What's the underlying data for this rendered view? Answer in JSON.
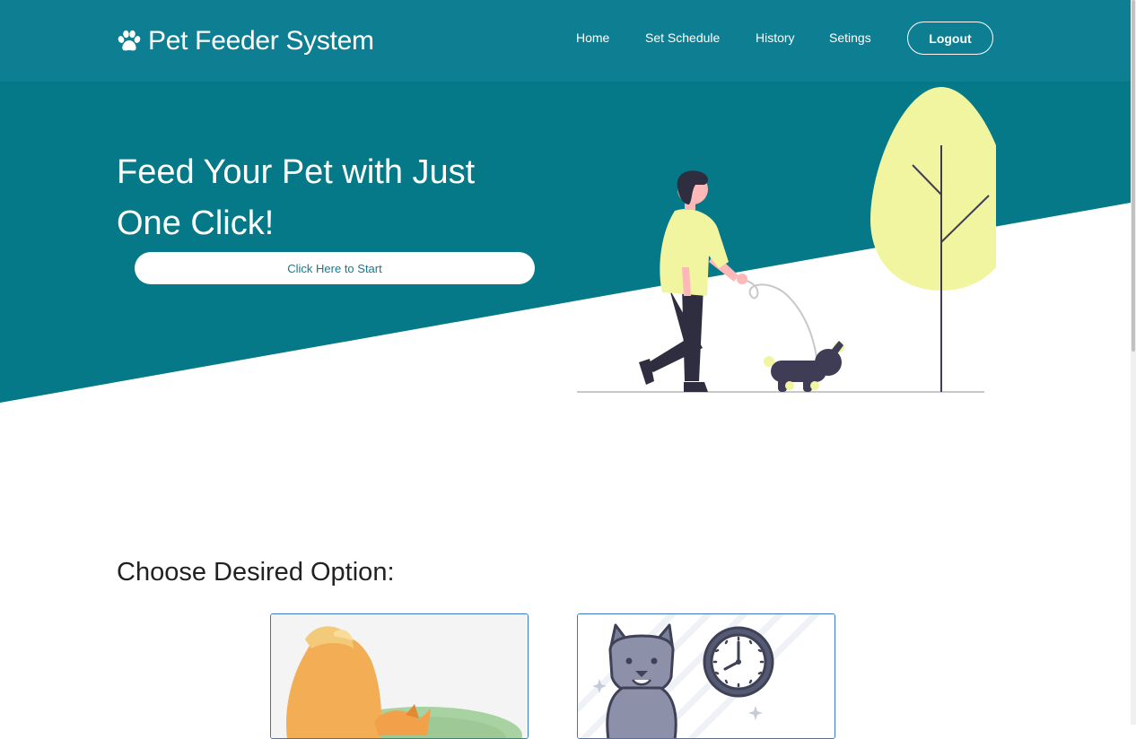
{
  "brand": {
    "title": "Pet Feeder System",
    "icon": "paw-icon"
  },
  "nav": {
    "items": [
      {
        "label": "Home"
      },
      {
        "label": "Set Schedule"
      },
      {
        "label": "History"
      },
      {
        "label": "Setings"
      }
    ],
    "logout_label": "Logout"
  },
  "hero": {
    "title": "Feed Your Pet with Just One Click!",
    "cta_label": "Click Here to Start",
    "illustration": "person-walking-dog-illustration"
  },
  "options": {
    "title": "Choose Desired Option:",
    "cards": [
      {
        "image": "cat-eating-illustration"
      },
      {
        "image": "dog-clock-illustration"
      }
    ]
  },
  "colors": {
    "primary": "#0e7f93",
    "hero": "#067989",
    "accent": "#f2f5a0",
    "card_border": "#3a78c4"
  }
}
